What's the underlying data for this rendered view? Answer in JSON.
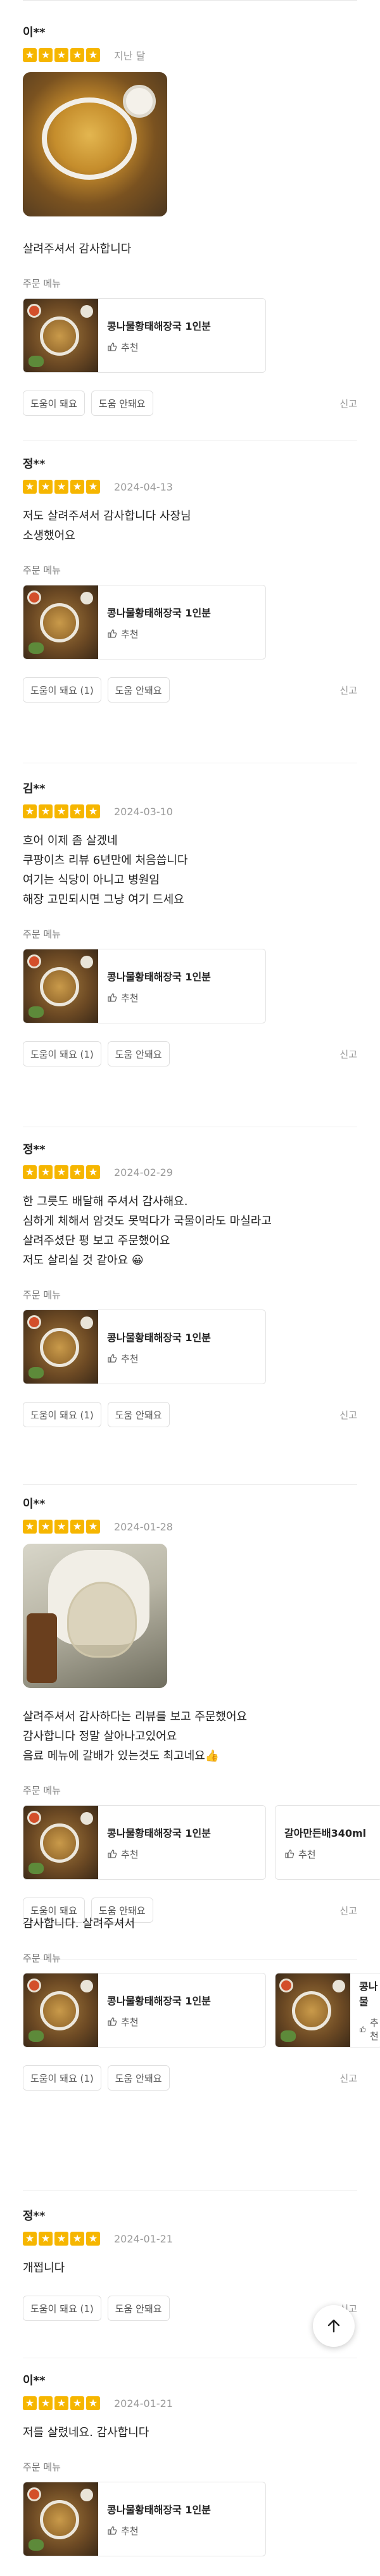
{
  "menu_label": "주문 메뉴",
  "recommend_label": "추천",
  "report_label": "신고",
  "reviews": [
    {
      "author": "이**",
      "stars": 5,
      "date": "지난 달",
      "text": "살려주셔서 감사합니다",
      "menus": [
        "콩나물황태해장국 1인분"
      ],
      "helpful": "도움이 돼요",
      "not_helpful": "도움 안돼요"
    },
    {
      "author": "정**",
      "stars": 5,
      "date": "2024-04-13",
      "text": "저도 살려주셔서 감사합니다 사장님\n소생했어요",
      "menus": [
        "콩나물황태해장국 1인분"
      ],
      "helpful": "도움이 돼요 (1)",
      "not_helpful": "도움 안돼요"
    },
    {
      "author": "김**",
      "stars": 5,
      "date": "2024-03-10",
      "text": "흐어 이제 좀 살겠네\n쿠팡이츠 리뷰 6년만에 처음씁니다\n여기는 식당이 아니고 병원임\n해장 고민되시면 그냥 여기 드세요",
      "menus": [
        "콩나물황태해장국 1인분"
      ],
      "helpful": "도움이 돼요 (1)",
      "not_helpful": "도움 안돼요"
    },
    {
      "author": "정**",
      "stars": 5,
      "date": "2024-02-29",
      "text": "한 그릇도 배달해 주셔서 감사해요.\n심하게 체해서 암것도 못먹다가 국물이라도 마실라고\n살려주셨단 평 보고 주문했어요\n저도 살리실 것  같아요 😀",
      "menus": [
        "콩나물황태해장국 1인분"
      ],
      "helpful": "도움이 돼요 (1)",
      "not_helpful": "도움 안돼요"
    },
    {
      "author": "이**",
      "stars": 5,
      "date": "2024-01-28",
      "text": "살려주셔서 감사하다는 리뷰를 보고 주문했어요\n감사합니다 정말 살아나고있어요\n음료 메뉴에 갈배가 있는것도 최고네요👍",
      "menus": [
        "콩나물황태해장국 1인분",
        "갈아만든배340ml"
      ],
      "helpful": "도움이 돼요",
      "not_helpful": "도움 안돼요"
    },
    {
      "text": "감사합니다. 살려주셔서",
      "menus": [
        "콩나물황태해장국 1인분",
        "콩나물"
      ],
      "helpful": "도움이 돼요 (1)",
      "not_helpful": "도움 안돼요"
    },
    {
      "author": "정**",
      "stars": 5,
      "date": "2024-01-21",
      "text": "개쩝니다",
      "helpful": "도움이 돼요 (1)",
      "not_helpful": "도움 안돼요"
    },
    {
      "author": "이**",
      "stars": 5,
      "date": "2024-01-21",
      "text": "저를 살렸네요. 감사합니다",
      "menus": [
        "콩나물황태해장국 1인분"
      ]
    }
  ],
  "icons": {
    "star": "star-icon",
    "thumbs_up": "thumbs-up-icon",
    "scroll_top": "arrow-up-icon"
  },
  "colors": {
    "star": "#f6b600",
    "text": "#222222",
    "muted": "#9a9a9a"
  }
}
